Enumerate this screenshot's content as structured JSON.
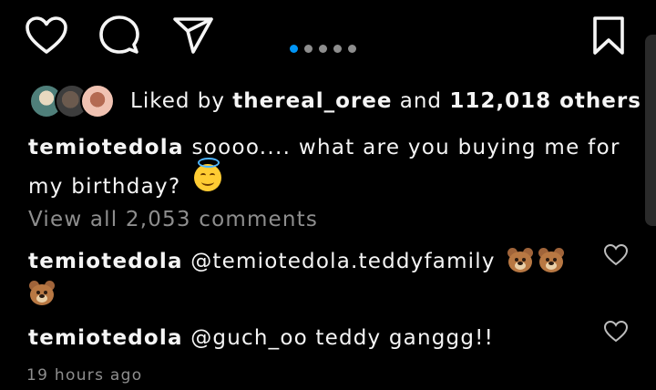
{
  "actions": {
    "like_icon": "heart-icon",
    "comment_icon": "comment-bubble-icon",
    "share_icon": "paper-plane-icon",
    "save_icon": "bookmark-icon",
    "carousel": {
      "count": 5,
      "active_index": 0
    }
  },
  "likes": {
    "prefix": "Liked by",
    "user": "thereal_oree",
    "connector": "and",
    "count": "112,018 others"
  },
  "caption": {
    "username": "temiotedola",
    "text": "soooo.... what are you buying me for my birthday?",
    "emoji": "smiling-face-with-halo"
  },
  "view_all_comments": "View all 2,053 comments",
  "comments": [
    {
      "username": "temiotedola",
      "text": "@temiotedola.teddyfamily",
      "emojis": [
        "bear-face",
        "bear-face",
        "bear-face"
      ]
    },
    {
      "username": "temiotedola",
      "text": "@guch_oo teddy ganggg!!",
      "emojis": []
    }
  ],
  "timestamp": "19 hours ago",
  "colors": {
    "background": "#000000",
    "text": "#f5f5f5",
    "muted": "#8e8e8e",
    "accent": "#0095f6"
  }
}
